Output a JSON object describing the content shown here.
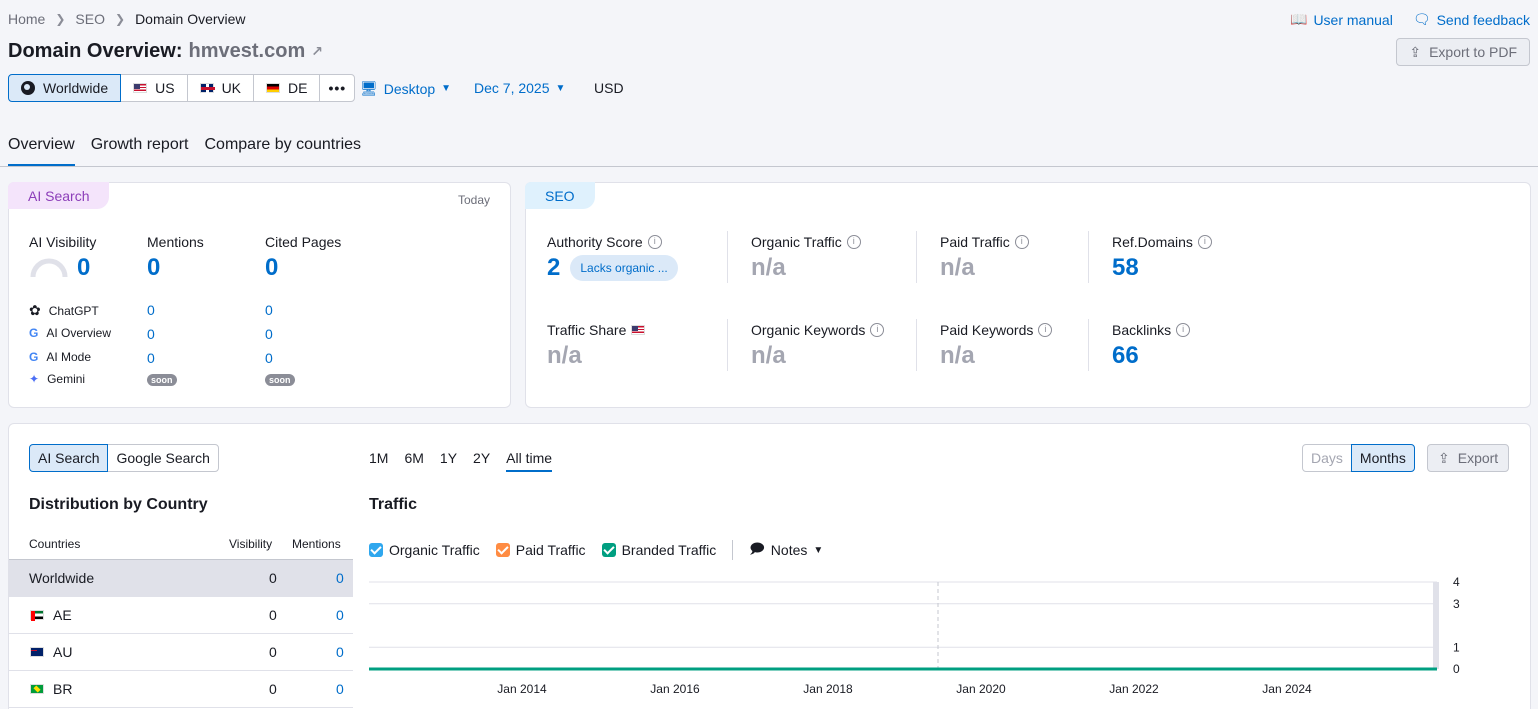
{
  "breadcrumb": {
    "home": "Home",
    "seo": "SEO",
    "current": "Domain Overview"
  },
  "top_links": {
    "manual": "User manual",
    "feedback": "Send feedback"
  },
  "title": {
    "prefix": "Domain Overview:",
    "domain": "hmvest.com"
  },
  "export_pdf": "Export to PDF",
  "databases": [
    {
      "label": "Worldwide"
    },
    {
      "label": "US"
    },
    {
      "label": "UK"
    },
    {
      "label": "DE"
    }
  ],
  "more": "•••",
  "device": "Desktop",
  "date": "Dec 7, 2025",
  "currency": "USD",
  "tabs": [
    "Overview",
    "Growth report",
    "Compare by countries"
  ],
  "ai_card": {
    "badge": "AI Search",
    "today": "Today",
    "visibility_label": "AI Visibility",
    "visibility_value": "0",
    "mentions_label": "Mentions",
    "mentions_value": "0",
    "cited_label": "Cited Pages",
    "cited_value": "0",
    "rows": [
      {
        "name": "ChatGPT",
        "mentions": "0",
        "cited": "0"
      },
      {
        "name": "AI Overview",
        "mentions": "0",
        "cited": "0"
      },
      {
        "name": "AI Mode",
        "mentions": "0",
        "cited": "0"
      },
      {
        "name": "Gemini",
        "mentions": "soon",
        "cited": "soon"
      }
    ]
  },
  "seo_card": {
    "badge": "SEO",
    "authority_label": "Authority Score",
    "authority_value": "2",
    "authority_pill": "Lacks organic ...",
    "organic_traffic_label": "Organic Traffic",
    "organic_traffic_value": "n/a",
    "paid_traffic_label": "Paid Traffic",
    "paid_traffic_value": "n/a",
    "ref_domains_label": "Ref.Domains",
    "ref_domains_value": "58",
    "traffic_share_label": "Traffic Share",
    "traffic_share_value": "n/a",
    "organic_keywords_label": "Organic Keywords",
    "organic_keywords_value": "n/a",
    "paid_keywords_label": "Paid Keywords",
    "paid_keywords_value": "n/a",
    "backlinks_label": "Backlinks",
    "backlinks_value": "66"
  },
  "bottom": {
    "source_toggle": [
      "AI Search",
      "Google Search"
    ],
    "periods": [
      "1M",
      "6M",
      "1Y",
      "2Y",
      "All time"
    ],
    "granularity": [
      "Days",
      "Months"
    ],
    "export": "Export",
    "dist_title": "Distribution by Country",
    "table_headers": [
      "Countries",
      "Visibility",
      "Mentions"
    ],
    "countries": [
      {
        "name": "Worldwide",
        "visibility": "0",
        "mentions": "0"
      },
      {
        "name": "AE",
        "visibility": "0",
        "mentions": "0"
      },
      {
        "name": "AU",
        "visibility": "0",
        "mentions": "0"
      },
      {
        "name": "BR",
        "visibility": "0",
        "mentions": "0"
      }
    ],
    "traffic_title": "Traffic",
    "legend": [
      {
        "label": "Organic Traffic",
        "color": "#2fa7ee"
      },
      {
        "label": "Paid Traffic",
        "color": "#ff8c43"
      },
      {
        "label": "Branded Traffic",
        "color": "#009f81"
      }
    ],
    "notes": "Notes"
  },
  "chart_data": {
    "type": "line",
    "x_ticks": [
      "Jan 2014",
      "Jan 2016",
      "Jan 2018",
      "Jan 2020",
      "Jan 2022",
      "Jan 2024"
    ],
    "y_ticks": [
      "4",
      "3",
      "1",
      "0"
    ],
    "series": [
      {
        "name": "Branded Traffic",
        "color": "#009f81",
        "values": [
          0,
          0,
          0,
          0,
          0,
          0,
          0
        ]
      }
    ]
  }
}
